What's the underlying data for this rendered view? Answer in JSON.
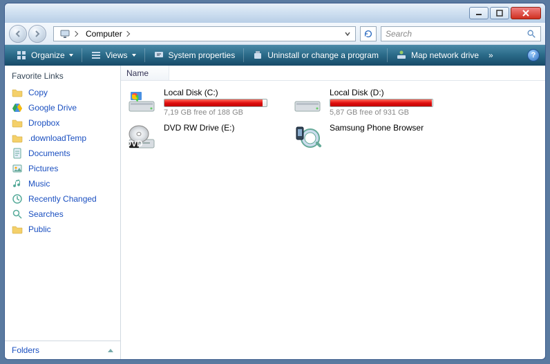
{
  "breadcrumb": {
    "root_icon": "computer",
    "location": "Computer"
  },
  "search": {
    "placeholder": "Search"
  },
  "toolbar": {
    "organize": "Organize",
    "views": "Views",
    "sysprops": "System properties",
    "uninstall": "Uninstall or change a program",
    "mapdrive": "Map network drive"
  },
  "sidebar": {
    "header": "Favorite Links",
    "items": [
      {
        "label": "Copy",
        "icon": "folder"
      },
      {
        "label": "Google Drive",
        "icon": "gdrive"
      },
      {
        "label": "Dropbox",
        "icon": "folder"
      },
      {
        "label": ".downloadTemp",
        "icon": "folder"
      },
      {
        "label": "Documents",
        "icon": "doc"
      },
      {
        "label": "Pictures",
        "icon": "pic"
      },
      {
        "label": "Music",
        "icon": "music"
      },
      {
        "label": "Recently Changed",
        "icon": "recent"
      },
      {
        "label": "Searches",
        "icon": "search"
      },
      {
        "label": "Public",
        "icon": "folder"
      }
    ],
    "footer": "Folders"
  },
  "columns": {
    "name": "Name"
  },
  "drives": [
    {
      "name": "Local Disk (C:)",
      "free": "7,19 GB free of 188 GB",
      "fill_pct": 96,
      "type": "hdd-win"
    },
    {
      "name": "Local Disk (D:)",
      "free": "5,87 GB free of 931 GB",
      "fill_pct": 99,
      "type": "hdd"
    },
    {
      "name": "DVD RW Drive (E:)",
      "free": "",
      "fill_pct": null,
      "type": "dvd"
    },
    {
      "name": "Samsung Phone Browser",
      "free": "",
      "fill_pct": null,
      "type": "phone"
    }
  ]
}
